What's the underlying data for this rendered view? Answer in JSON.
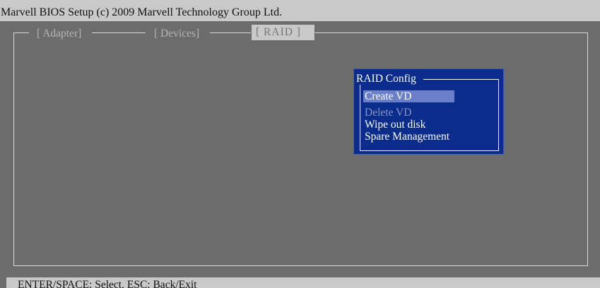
{
  "title_bar": {
    "text": "Marvell BIOS Setup (c) 2009 Marvell Technology Group Ltd."
  },
  "tabs": [
    {
      "label": "[ Adapter]",
      "active": false
    },
    {
      "label": "[ Devices]",
      "active": false
    },
    {
      "label": "[  RAID  ]",
      "active": true
    }
  ],
  "raid_config_menu": {
    "title": "RAID Config",
    "items": [
      {
        "label": "Create VD",
        "state": "selected"
      },
      {
        "label": "Delete VD",
        "state": "disabled"
      },
      {
        "label": "Wipe out disk",
        "state": "normal"
      },
      {
        "label": "Spare Management",
        "state": "normal"
      }
    ]
  },
  "status_bar": {
    "text": "ENTER/SPACE: Select, ESC: Back/Exit"
  },
  "colors": {
    "background": "#6c6c6c",
    "bar": "#c9c9c9",
    "popup": "#0a2c8a",
    "selection": "#6b7fc8",
    "frame": "#d8d8d8"
  }
}
